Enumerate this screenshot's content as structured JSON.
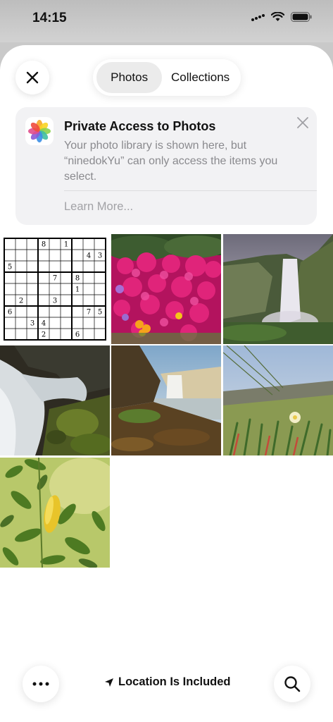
{
  "status_bar": {
    "time": "14:15"
  },
  "tabs": [
    {
      "label": "Photos",
      "active": true
    },
    {
      "label": "Collections",
      "active": false
    }
  ],
  "banner": {
    "title": "Private Access to Photos",
    "body": "Your photo library is shown here, but “ninedokYu” can only access the items you select.",
    "link": "Learn More..."
  },
  "sudoku": {
    "cells": [
      [
        "",
        "",
        "",
        "8",
        "",
        "1",
        "",
        "",
        ""
      ],
      [
        "",
        "",
        "",
        "",
        "",
        "",
        "",
        "4",
        "3"
      ],
      [
        "5",
        "",
        "",
        "",
        "",
        "",
        "",
        "",
        ""
      ],
      [
        "",
        "",
        "",
        "",
        "7",
        "",
        "8",
        "",
        ""
      ],
      [
        "",
        "",
        "",
        "",
        "",
        "",
        "1",
        "",
        ""
      ],
      [
        "",
        "2",
        "",
        "",
        "3",
        "",
        "",
        "",
        ""
      ],
      [
        "6",
        "",
        "",
        "",
        "",
        "",
        "",
        "7",
        "5"
      ],
      [
        "",
        "",
        "3",
        "4",
        "",
        "",
        "",
        "",
        ""
      ],
      [
        "",
        "",
        "",
        "2",
        "",
        "",
        "6",
        "",
        ""
      ]
    ]
  },
  "photos": [
    {
      "name": "sudoku-screenshot"
    },
    {
      "name": "pink-flowers-photo"
    },
    {
      "name": "waterfall-cliff-photo"
    },
    {
      "name": "waterfall-closeup-photo"
    },
    {
      "name": "waterfall-landscape-photo"
    },
    {
      "name": "flower-field-photo"
    },
    {
      "name": "green-leaves-photo"
    }
  ],
  "bottom": {
    "location_label": "Location Is Included"
  },
  "icons": {
    "close": "close-icon",
    "more": "more-icon",
    "location": "location-arrow-icon",
    "search": "search-icon",
    "photos_app": "photos-app-icon"
  }
}
